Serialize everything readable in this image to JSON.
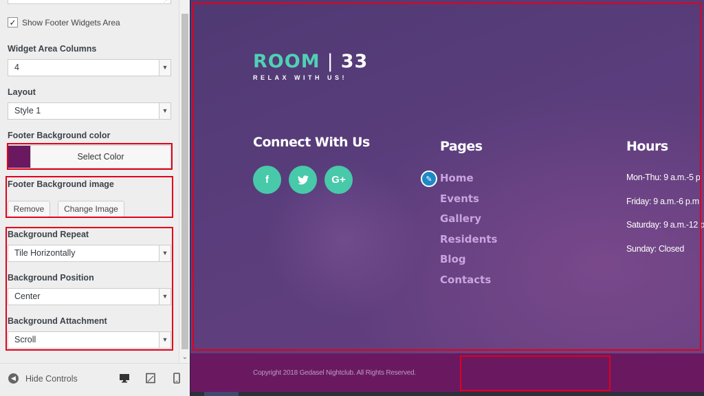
{
  "sidebar": {
    "show_footer_widgets": {
      "label": "Show Footer Widgets Area",
      "checked": true
    },
    "widget_columns": {
      "label": "Widget Area Columns",
      "value": "4"
    },
    "layout": {
      "label": "Layout",
      "value": "Style 1"
    },
    "footer_bg_color": {
      "label": "Footer Background color",
      "button": "Select Color",
      "color": "#6a1960"
    },
    "footer_bg_image": {
      "label": "Footer Background image",
      "remove": "Remove",
      "change": "Change Image"
    },
    "bg_repeat": {
      "label": "Background Repeat",
      "value": "Tile Horizontally"
    },
    "bg_position": {
      "label": "Background Position",
      "value": "Center"
    },
    "bg_attachment": {
      "label": "Background Attachment",
      "value": "Scroll"
    },
    "hide_controls": "Hide Controls"
  },
  "preview": {
    "logo": {
      "room": "ROOM",
      "separator": "|",
      "number": "33",
      "tagline": "RELAX WITH US!"
    },
    "connect_title": "Connect With Us",
    "social": [
      {
        "icon": "facebook-icon",
        "glyph": "f"
      },
      {
        "icon": "twitter-icon",
        "glyph": "🐦"
      },
      {
        "icon": "google-plus-icon",
        "glyph": "G+"
      }
    ],
    "pages_title": "Pages",
    "pages": [
      "Home",
      "Events",
      "Gallery",
      "Residents",
      "Blog",
      "Contacts"
    ],
    "hours_title": "Hours",
    "hours": [
      "Mon-Thu: 9 a.m.-5 p",
      "Friday: 9 a.m.-6 p.m",
      "Saturday: 9 a.m.-12 p",
      "Sunday: Closed"
    ],
    "copyright": "Copyright 2018 Gedasel Nightclub. All Rights Reserved."
  },
  "colors": {
    "accent": "#48c9a9",
    "footer_bottom": "#6a1960",
    "highlight_box": "#e2001a"
  }
}
